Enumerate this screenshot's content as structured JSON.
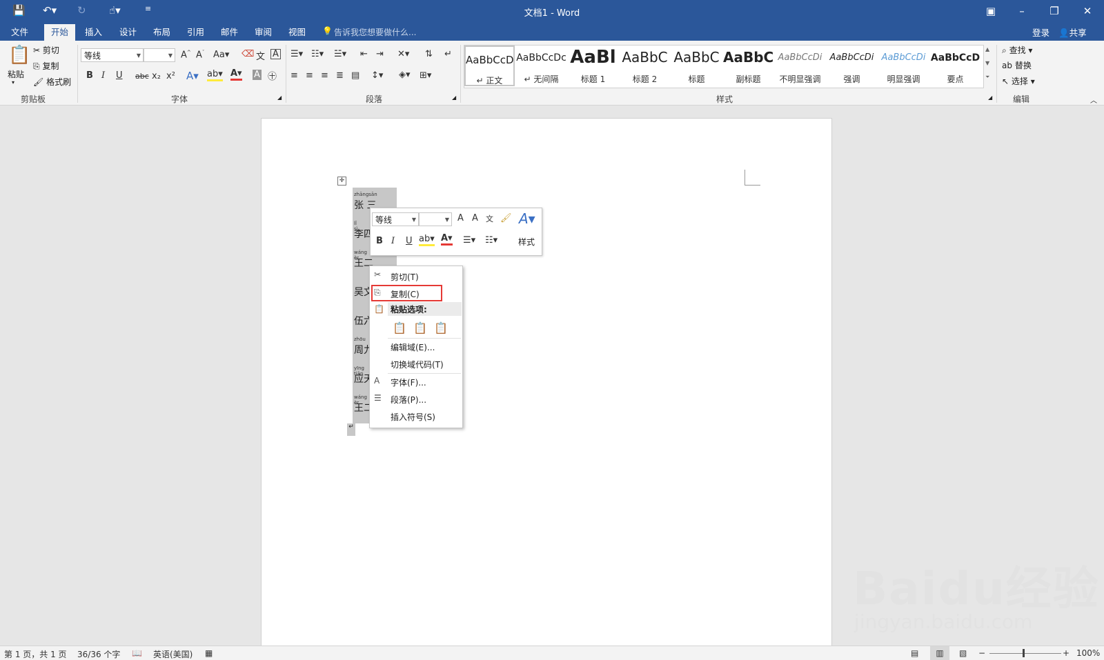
{
  "title_bar": {
    "title": "文档1 - Word"
  },
  "tabs": [
    "文件",
    "开始",
    "插入",
    "设计",
    "布局",
    "引用",
    "邮件",
    "审阅",
    "视图"
  ],
  "tell_me": "告诉我您想要做什么...",
  "account": {
    "login": "登录",
    "share": "共享"
  },
  "clipboard": {
    "paste": "粘贴",
    "cut": "剪切",
    "copy": "复制",
    "format_painter": "格式刷",
    "label": "剪贴板"
  },
  "font": {
    "name": "等线",
    "label": "字体",
    "bold": "B",
    "italic": "I",
    "underline": "U",
    "strike": "abc",
    "sub": "x₂",
    "sup": "x²",
    "aa": "Aa"
  },
  "paragraph": {
    "label": "段落"
  },
  "styles": {
    "label": "样式",
    "items": [
      {
        "preview": "AaBbCcDc",
        "name": "正文"
      },
      {
        "preview": "AaBbCcDc",
        "name": "无间隔"
      },
      {
        "preview": "AaBl",
        "name": "标题 1"
      },
      {
        "preview": "AaBbC",
        "name": "标题 2"
      },
      {
        "preview": "AaBbC",
        "name": "标题"
      },
      {
        "preview": "AaBbC",
        "name": "副标题"
      },
      {
        "preview": "AaBbCcDi",
        "name": "不明显强调"
      },
      {
        "preview": "AaBbCcDi",
        "name": "强调"
      },
      {
        "preview": "AaBbCcDi",
        "name": "明显强调"
      },
      {
        "preview": "AaBbCcD",
        "name": "要点"
      }
    ]
  },
  "editing": {
    "find": "查找",
    "replace": "替换",
    "select": "选择",
    "label": "编辑"
  },
  "table": {
    "names": [
      "张 三",
      "李四",
      "王二",
      "吴文",
      "伍六",
      "周九",
      "应天",
      "王二"
    ],
    "pinyin": [
      "zhāngsān",
      "lǐ sì",
      "wáng èr",
      "",
      "",
      "zhōu",
      "yīng tiān",
      "wáng èr"
    ]
  },
  "mini_toolbar": {
    "font": "等线",
    "styles": "样式",
    "bold": "B",
    "italic": "I",
    "underline": "U"
  },
  "context_menu": {
    "cut": "剪切(T)",
    "copy": "复制(C)",
    "paste_options": "粘贴选项:",
    "edit_field": "编辑域(E)...",
    "toggle_field": "切换域代码(T)",
    "font": "字体(F)...",
    "paragraph": "段落(P)...",
    "insert_symbol": "插入符号(S)"
  },
  "status_bar": {
    "page": "第 1 页，共 1 页",
    "words": "36/36 个字",
    "language": "英语(美国)",
    "zoom": "100%"
  },
  "watermark": {
    "brand": "Baidu经验",
    "url": "jingyan.baidu.com"
  },
  "colors": {
    "accent": "#2b579a",
    "highlight_red": "#e53935"
  }
}
